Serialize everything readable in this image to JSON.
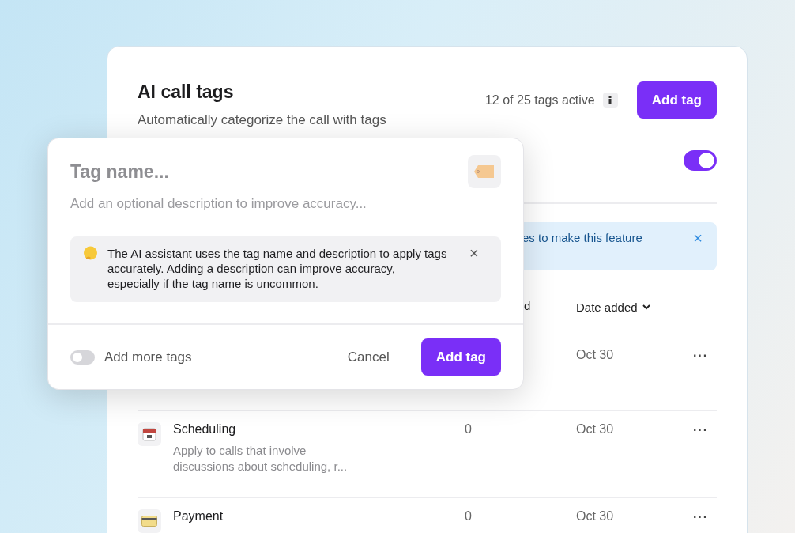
{
  "page": {
    "title": "AI call tags",
    "subtitle": "Automatically categorize the call with tags",
    "active_count": "12 of 25 tags active",
    "add_button": "Add tag",
    "feature_toggle": {
      "on": true
    }
  },
  "banner": {
    "text": "es to make this feature",
    "close": "×"
  },
  "table": {
    "columns": [
      {
        "label": "d",
        "sortable": false
      },
      {
        "label": "Date added",
        "sortable": true
      }
    ],
    "rows": [
      {
        "kind": "hidden",
        "name": "",
        "description": "",
        "count": "",
        "date": "Oct 30",
        "menu": "···"
      },
      {
        "kind": "calendar",
        "name": "Scheduling",
        "description": "Apply to calls that involve discussions about scheduling, r...",
        "count": "0",
        "date": "Oct 30",
        "menu": "···"
      },
      {
        "kind": "card",
        "name": "Payment",
        "description": "",
        "count": "0",
        "date": "Oct 30",
        "menu": "···"
      }
    ]
  },
  "dialog": {
    "name_placeholder": "Tag name...",
    "description_placeholder": "Add an optional description to improve accuracy...",
    "hint": "The AI assistant uses the tag name and description to apply tags accurately. Adding a description can improve accuracy, especially if the tag name is uncommon.",
    "hint_close": "×",
    "more_toggle": {
      "on": false,
      "label": "Add more tags"
    },
    "cancel": "Cancel",
    "submit": "Add tag"
  }
}
